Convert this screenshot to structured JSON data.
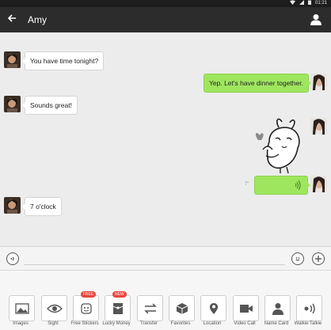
{
  "status_bar": {
    "time": "01:21"
  },
  "header": {
    "back_icon": "back-arrow-icon",
    "title": "Amy",
    "profile_icon": "person-icon"
  },
  "messages": [
    {
      "side": "left",
      "type": "text",
      "text": "You have time tonight?"
    },
    {
      "side": "right",
      "type": "text",
      "text": "Yep. Let's have dinner together."
    },
    {
      "side": "left",
      "type": "text",
      "text": "Sounds great!"
    },
    {
      "side": "right",
      "type": "sticker",
      "sticker": "rabbit-sticker"
    },
    {
      "side": "right",
      "type": "voice",
      "duration": "7\""
    },
    {
      "side": "left",
      "type": "text",
      "text": "7 o'clock"
    }
  ],
  "input_bar": {
    "voice_icon": "voice-icon",
    "emoji_icon": "emoji-icon",
    "add_icon": "plus-icon"
  },
  "toolbar": [
    {
      "label": "Images",
      "icon": "image-icon"
    },
    {
      "label": "Sight",
      "icon": "eye-icon"
    },
    {
      "label": "Free Stickers",
      "icon": "sticker-icon",
      "badge": "FREE"
    },
    {
      "label": "Lucky Money",
      "icon": "red-packet-icon",
      "badge": "NEW"
    },
    {
      "label": "Transfer",
      "icon": "transfer-icon"
    },
    {
      "label": "Favorites",
      "icon": "cube-icon"
    },
    {
      "label": "Location",
      "icon": "location-pin-icon"
    },
    {
      "label": "Video Call",
      "icon": "video-camera-icon"
    },
    {
      "label": "Name Card",
      "icon": "name-card-icon"
    },
    {
      "label": "Walkie Talkie",
      "icon": "walkie-talkie-icon"
    }
  ],
  "colors": {
    "header_bg": "#2c2c2c",
    "sent_bubble": "#9fe65f",
    "received_bubble": "#ffffff",
    "badge": "#e8453c",
    "chat_bg": "#ececec"
  }
}
